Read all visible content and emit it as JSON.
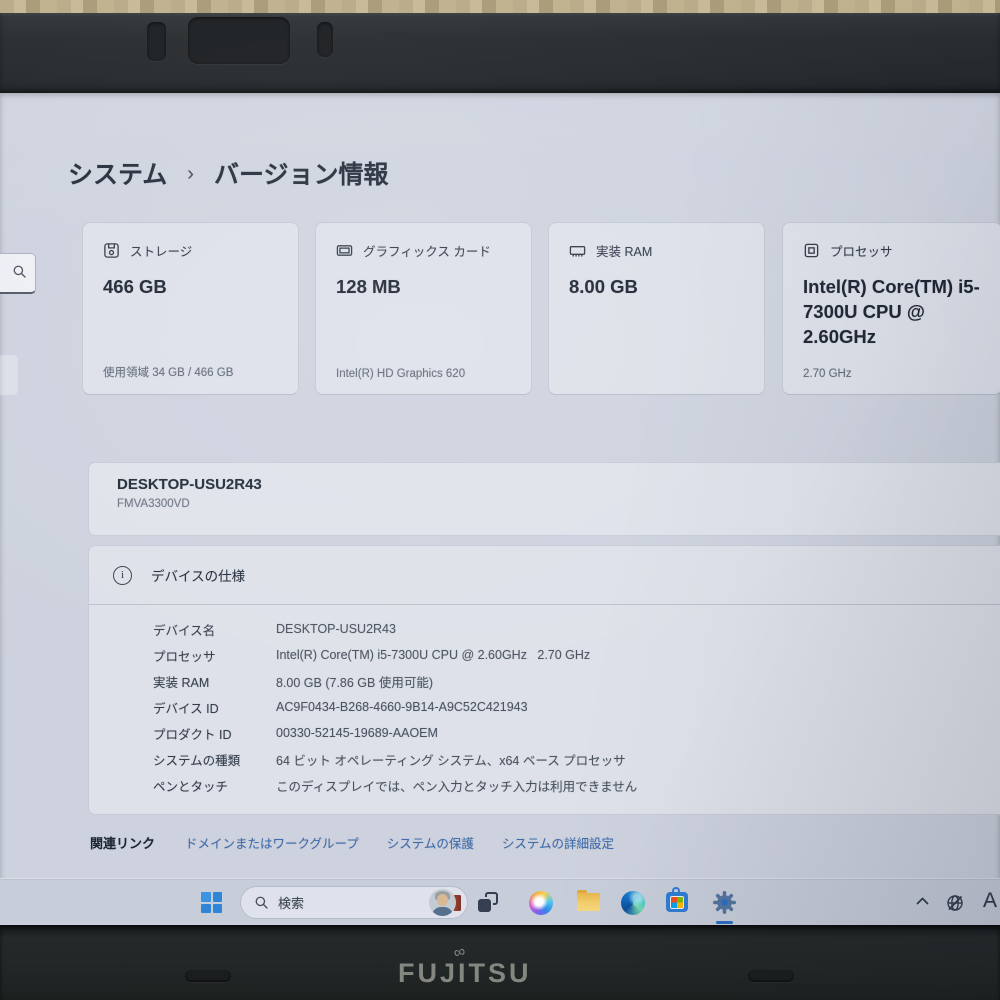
{
  "chassis": {
    "brand_logo": "FUJITSU",
    "brand_mark": "∞"
  },
  "settings": {
    "breadcrumb": {
      "root": "システム",
      "separator": "›",
      "current": "バージョン情報"
    },
    "cards": [
      {
        "icon": "storage-icon",
        "label": "ストレージ",
        "value": "466 GB",
        "footer": "使用領域 34 GB / 466 GB"
      },
      {
        "icon": "gpu-icon",
        "label": "グラフィックス カード",
        "value": "128 MB",
        "footer": "Intel(R) HD Graphics 620"
      },
      {
        "icon": "ram-icon",
        "label": "実装 RAM",
        "value": "8.00 GB",
        "footer": ""
      },
      {
        "icon": "cpu-icon",
        "label": "プロセッサ",
        "value": "Intel(R) Core(TM) i5-7300U CPU @ 2.60GHz",
        "footer": "2.70 GHz"
      }
    ],
    "device": {
      "name": "DESKTOP-USU2R43",
      "model": "FMVA3300VD"
    },
    "specs": {
      "title": "デバイスの仕様",
      "info_glyph": "i",
      "rows": [
        {
          "label": "デバイス名",
          "value": "DESKTOP-USU2R43"
        },
        {
          "label": "プロセッサ",
          "value": "Intel(R) Core(TM) i5-7300U CPU @ 2.60GHz   2.70 GHz"
        },
        {
          "label": "実装 RAM",
          "value": "8.00 GB (7.86 GB 使用可能)"
        },
        {
          "label": "デバイス ID",
          "value": "AC9F0434-B268-4660-9B14-A9C52C421943"
        },
        {
          "label": "プロダクト ID",
          "value": "00330-52145-19689-AAOEM"
        },
        {
          "label": "システムの種類",
          "value": "64 ビット オペレーティング システム、x64 ベース プロセッサ"
        },
        {
          "label": "ペンとタッチ",
          "value": "このディスプレイでは、ペン入力とタッチ入力は利用できません"
        }
      ]
    },
    "related": {
      "label": "関連リンク",
      "links": [
        "ドメインまたはワークグループ",
        "システムの保護",
        "システムの詳細設定"
      ]
    }
  },
  "taskbar": {
    "search_placeholder": "検索",
    "ime_indicator": "A"
  },
  "colors": {
    "accent_blue": "#2d6fc1",
    "link_blue": "#3e6cae",
    "page_bg": "#cdd2de",
    "card_bg": "#dde0e9",
    "text_dark": "#1a2231"
  }
}
